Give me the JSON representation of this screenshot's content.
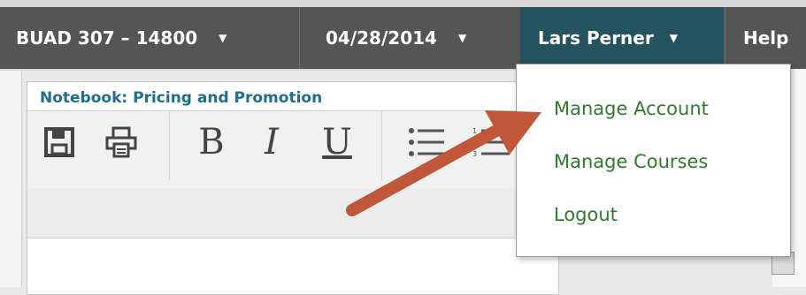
{
  "nav": {
    "course": "BUAD 307 – 14800",
    "date": "04/28/2014",
    "user": "Lars Perner",
    "help": "Help",
    "caret": "▼"
  },
  "editor": {
    "title": "Notebook: Pricing and Promotion",
    "toolbar": {
      "bold": "B",
      "italic": "I",
      "underline": "U"
    }
  },
  "user_menu": {
    "items": [
      "Manage Account",
      "Manage Courses",
      "Logout"
    ]
  },
  "annotation": {
    "arrow_color": "#c0563a"
  }
}
